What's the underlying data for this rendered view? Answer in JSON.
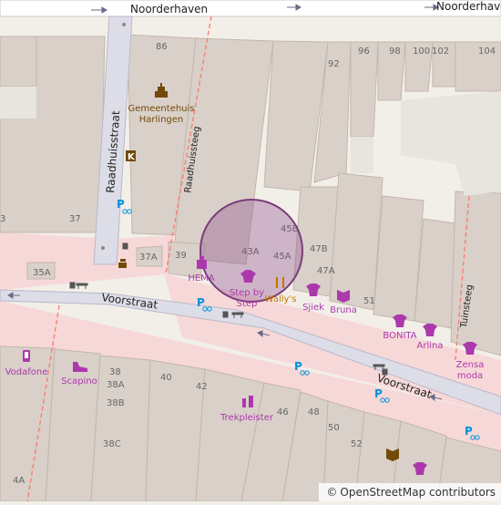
{
  "streets": {
    "noorderhaven_1": "Noorderhaven",
    "noorderhaven_2": "Noorderhaven",
    "raadhuisstraat": "Raadhuisstraat",
    "raadhuissteeg": "Raadhuissteeg",
    "voorstraat_1": "Voorstraat",
    "voorstraat_2": "Voorstraat",
    "tuinsteeg": "Tuinsteeg"
  },
  "house_numbers": {
    "n86": "86",
    "n92": "92",
    "n96": "96",
    "n98": "98",
    "n100": "100",
    "n102": "102",
    "n104": "104",
    "n37": "37",
    "n37A": "37A",
    "n39": "39",
    "n43A": "43A",
    "n45A": "45A",
    "n45B": "45B",
    "n47B": "47B",
    "n47A": "47A",
    "n51": "51",
    "n35A": "35A",
    "n3": "3",
    "n38": "38",
    "n38A": "38A",
    "n38B": "38B",
    "n38C": "38C",
    "n40": "40",
    "n42": "42",
    "n46": "46",
    "n48": "48",
    "n50": "50",
    "n52": "52",
    "n4A": "4A"
  },
  "pois": {
    "gemeentehuis_1": "Gemeentehuis",
    "gemeentehuis_2": "Harlingen",
    "hema": "HEMA",
    "step_by_step_1": "Step by",
    "step_by_step_2": "Step",
    "wallys": "Wally's",
    "sjiek": "Sjiek",
    "bruna": "Bruna",
    "bonita": "BONITA",
    "arlina": "Arlina",
    "zensa_1": "Zensa",
    "zensa_2": "moda",
    "vodafone": "Vodafone",
    "scapino": "Scapino",
    "trekpleister": "Trekpleister"
  },
  "attribution": {
    "copyright": "©",
    "text": "OpenStreetMap contributors"
  },
  "colors": {
    "land": "#f2efe9",
    "building": "#d9d0c9",
    "building_stroke": "#c4b6ab",
    "pedestrian": "#f7d8d8",
    "street": "#dddde8",
    "shop": "#ac39ac",
    "amenity": "#734a08",
    "parking": "#0092da",
    "marker_fill": "#8a4a8a"
  }
}
